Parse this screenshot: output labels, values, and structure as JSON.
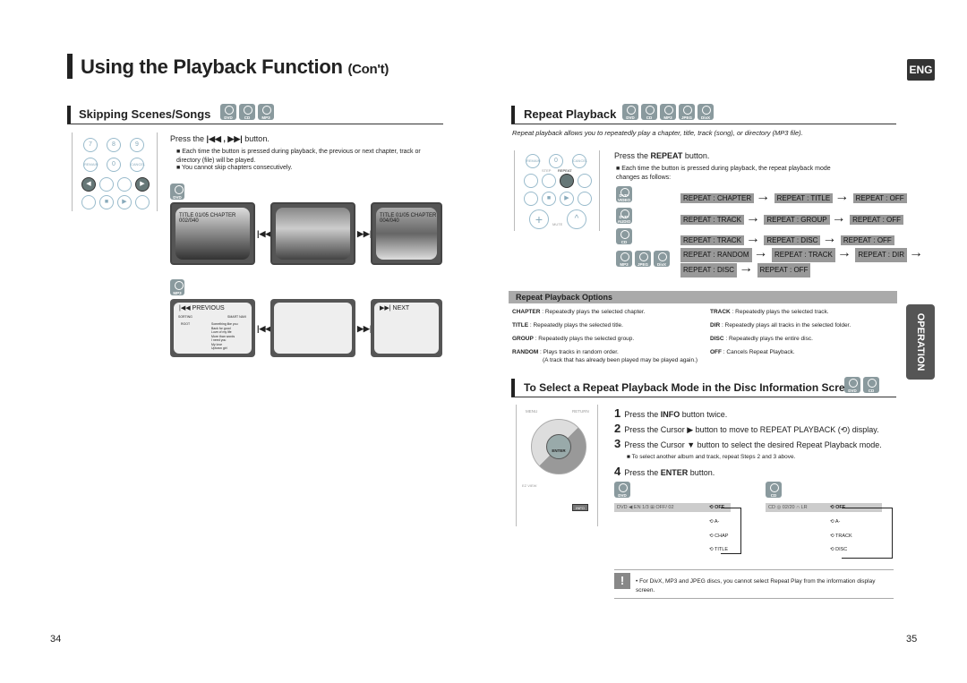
{
  "header": {
    "title": "Using the Playback Function",
    "title_suffix": "(Con't)",
    "lang_badge": "ENG"
  },
  "left": {
    "section_title": "Skipping Scenes/Songs",
    "discs": [
      "DVD",
      "CD",
      "MP3"
    ],
    "remote_buttons": [
      "7",
      "8",
      "9",
      "REMAIN",
      "0",
      "CANCEL",
      "STEP",
      "REPEAT",
      "STOP",
      "PLAY"
    ],
    "instruction_prefix": "Press the",
    "instruction_icons": "|◀◀ , ▶▶|",
    "instruction_suffix": "button.",
    "bullets": [
      "Each time the button is pressed during playback, the previous or next chapter, track or directory (file) will be played.",
      "You cannot skip chapters consecutively."
    ],
    "dvd_label": "DVD",
    "dvd_captions": [
      "TITLE 01/05 CHAPTER 002/040",
      "TITLE 01/05 CHAPTER 004/040"
    ],
    "mp3_label": "MP3",
    "mp3_screens": [
      "PREVIOUS",
      "",
      "NEXT"
    ],
    "mp3_menu": {
      "sorting": "SORTING",
      "smart": "SMART NAVI",
      "root": "ROOT",
      "songs": [
        "Something like you",
        "Back for good",
        "Love of my life",
        "More than words",
        "I need you",
        "My love",
        "Uptown girl"
      ]
    },
    "prev_icon": "|◀◀",
    "next_icon": "▶▶|",
    "page_number": "34"
  },
  "right": {
    "section_title": "Repeat Playback",
    "discs": [
      "DVD",
      "CD",
      "MP3",
      "JPEG",
      "DivX"
    ],
    "intro": "Repeat playback allows you to repeatedly play a chapter, title, track (song), or directory (MP3 file).",
    "remote_buttons": [
      "REMAIN",
      "0",
      "CANCEL",
      "STEP",
      "REPEAT",
      "STOP",
      "PLAY",
      "MUTE"
    ],
    "instruction_prefix": "Press the",
    "instruction_key": "REPEAT",
    "instruction_suffix": "button.",
    "bullet": "Each time the button is pressed during playback, the repeat playback mode changes as follows:",
    "sequences": [
      {
        "discs": [
          "DVD-VIDEO"
        ],
        "steps": [
          "REPEAT : CHAPTER",
          "REPEAT : TITLE",
          "REPEAT : OFF"
        ]
      },
      {
        "discs": [
          "DVD-AUDIO"
        ],
        "steps": [
          "REPEAT : TRACK",
          "REPEAT : GROUP",
          "REPEAT : OFF"
        ]
      },
      {
        "discs": [
          "CD"
        ],
        "steps": [
          "REPEAT : TRACK",
          "REPEAT : DISC",
          "REPEAT : OFF"
        ]
      },
      {
        "discs": [
          "MP3",
          "JPEG",
          "DivX"
        ],
        "steps": [
          "REPEAT : RANDOM",
          "REPEAT : TRACK",
          "REPEAT : DIR",
          "REPEAT : DISC",
          "REPEAT : OFF"
        ]
      }
    ],
    "options_title": "Repeat Playback Options",
    "options_left": [
      {
        "key": "CHAPTER",
        "desc": " : Repeatedly plays the selected chapter."
      },
      {
        "key": "TITLE",
        "desc": " : Repeatedly plays the selected title."
      },
      {
        "key": "GROUP",
        "desc": " : Repeatedly plays the selected group."
      },
      {
        "key": "RANDOM",
        "desc": " : Plays tracks in random order."
      }
    ],
    "random_note": "(A track that has already been played may be played again.)",
    "options_right": [
      {
        "key": "TRACK",
        "desc": " : Repeatedly plays the selected track."
      },
      {
        "key": "DIR",
        "desc": " : Repeatedly plays all tracks in the selected folder."
      },
      {
        "key": "DISC",
        "desc": " : Repeatedly plays the entire disc."
      },
      {
        "key": "OFF",
        "desc": " : Cancels Repeat Playback."
      }
    ],
    "side_tab": "OPERATION",
    "section2_title": "To Select a Repeat Playback Mode in the Disc Information Screen",
    "section2_discs": [
      "DVD",
      "CD"
    ],
    "remote2_buttons": [
      "MENU",
      "RETURN",
      "ENTER",
      "EZ VIEW",
      "INFO"
    ],
    "steps": [
      {
        "n": "1",
        "pre": "Press the ",
        "key": "INFO",
        "post": " button twice."
      },
      {
        "n": "2",
        "pre": "Press the Cursor ▶ button to move to REPEAT PLAYBACK (⟲) display.",
        "key": "",
        "post": ""
      },
      {
        "n": "3",
        "pre": "Press the Cursor ▼ button to select the desired Repeat Playback mode.",
        "key": "",
        "post": ""
      },
      {
        "n": "4",
        "pre": "Press the ",
        "key": "ENTER",
        "post": " button."
      }
    ],
    "step3_note": "To select another album and track, repeat Steps 2 and 3 above.",
    "dvd_info": {
      "label": "DVD",
      "bar": "DVD  ◀  EN 1/3  ⊞  OFF/ 02",
      "modes": [
        "⟲ OFF",
        "⟲ A-",
        "⟲ CHAP",
        "⟲ TITLE"
      ]
    },
    "cd_info": {
      "label": "CD",
      "bar": "CD  ◎ 02/20  ∩ LR",
      "modes": [
        "⟲ OFF",
        "⟲ A-",
        "⟲ TRACK",
        "⟲ DISC"
      ]
    },
    "note": "• For DivX, MP3 and JPEG discs, you cannot select Repeat Play from the information display screen.",
    "page_number": "35"
  }
}
